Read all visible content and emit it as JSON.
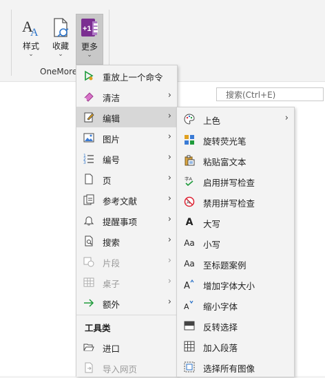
{
  "ribbon": {
    "buttons": [
      {
        "label": "样式",
        "icon": "styles-icon"
      },
      {
        "label": "收藏",
        "icon": "favorites-icon"
      },
      {
        "label": "更多",
        "icon": "more-icon",
        "active": true
      }
    ],
    "group_label": "OneMore",
    "more_badge": "+1"
  },
  "search": {
    "placeholder": "搜索(Ctrl+E)"
  },
  "main_menu": {
    "items": [
      {
        "label": "重放上一个命令",
        "icon": "replay-icon",
        "submenu": false
      },
      {
        "label": "清洁",
        "icon": "eraser-icon",
        "submenu": true
      },
      {
        "label": "编辑",
        "icon": "edit-icon",
        "submenu": true,
        "highlighted": true
      },
      {
        "label": "图片",
        "icon": "image-icon",
        "submenu": true
      },
      {
        "label": "编号",
        "icon": "numbering-icon",
        "submenu": true
      },
      {
        "label": "页",
        "icon": "page-icon",
        "submenu": true
      },
      {
        "label": "参考文献",
        "icon": "references-icon",
        "submenu": true
      },
      {
        "label": "提醒事项",
        "icon": "bell-icon",
        "submenu": true
      },
      {
        "label": "搜索",
        "icon": "search-doc-icon",
        "submenu": true
      },
      {
        "label": "片段",
        "icon": "snippet-icon",
        "submenu": true,
        "disabled": true
      },
      {
        "label": "桌子",
        "icon": "table-icon",
        "submenu": true,
        "disabled": true
      },
      {
        "label": "额外",
        "icon": "arrow-right-icon",
        "submenu": true
      }
    ],
    "section_header": "工具类",
    "tool_items": [
      {
        "label": "进口",
        "icon": "folder-open-icon",
        "disabled": false
      },
      {
        "label": "导入网页",
        "icon": "import-web-icon",
        "disabled": true
      }
    ]
  },
  "sub_menu": {
    "items": [
      {
        "label": "上色",
        "icon": "palette-icon",
        "submenu": true
      },
      {
        "label": "旋转荧光笔",
        "icon": "rotate-highlighter-icon",
        "submenu": false
      },
      {
        "label": "粘贴富文本",
        "icon": "paste-rich-text-icon",
        "submenu": false
      },
      {
        "label": "启用拼写检查",
        "icon": "spellcheck-enable-icon",
        "submenu": false
      },
      {
        "label": "禁用拼写检查",
        "icon": "spellcheck-disable-icon",
        "submenu": false
      },
      {
        "label": "大写",
        "icon": "uppercase-icon",
        "glyph": "A",
        "submenu": false
      },
      {
        "label": "小写",
        "icon": "lowercase-icon",
        "glyph": "Aa",
        "submenu": false
      },
      {
        "label": "至标题案例",
        "icon": "titlecase-icon",
        "glyph": "Aa",
        "submenu": false
      },
      {
        "label": "增加字体大小",
        "icon": "increase-font-icon",
        "glyph": "A^",
        "submenu": false
      },
      {
        "label": "缩小字体",
        "icon": "decrease-font-icon",
        "glyph": "Aˇ",
        "submenu": false
      },
      {
        "label": "反转选择",
        "icon": "invert-selection-icon",
        "submenu": false
      },
      {
        "label": "加入段落",
        "icon": "join-paragraph-icon",
        "submenu": false
      },
      {
        "label": "选择所有图像",
        "icon": "select-images-icon",
        "submenu": false
      }
    ]
  },
  "colors": {
    "accent": "#7b2e91",
    "highlight": "#d7d7d7",
    "menu_bg": "#f3f3f3",
    "disabled_text": "#9b9b9b"
  }
}
